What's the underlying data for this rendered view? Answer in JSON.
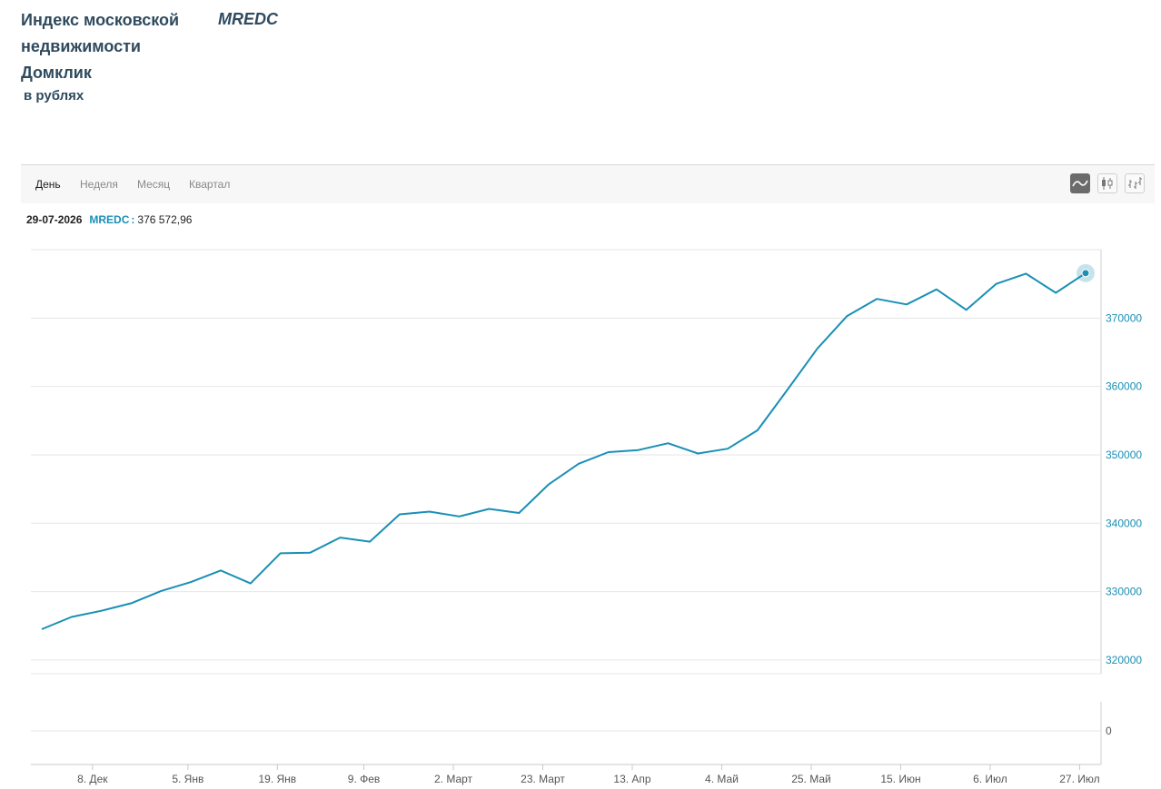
{
  "header": {
    "title_lines": [
      "Индекс московской",
      "недвижимости",
      "Домклик"
    ],
    "ticker": "MREDC",
    "units": "в рублях"
  },
  "tabs": [
    {
      "label": "День",
      "active": true
    },
    {
      "label": "Неделя",
      "active": false
    },
    {
      "label": "Месяц",
      "active": false
    },
    {
      "label": "Квартал",
      "active": false
    }
  ],
  "chart_types": [
    {
      "icon": "line-chart-icon",
      "active": true
    },
    {
      "icon": "candlestick-chart-icon",
      "active": false
    },
    {
      "icon": "ohlc-bar-chart-icon",
      "active": false
    }
  ],
  "readout": {
    "date": "29-07-2026",
    "symbol": "MREDC",
    "value": "376 572,96"
  },
  "colors": {
    "line": "#1a8fb5",
    "axis_text": "#1a8fb5",
    "grid": "#e6e6e6",
    "title": "#2f4a5e"
  },
  "chart_data": {
    "type": "line",
    "series": [
      {
        "values": [
          324500,
          326300,
          327200,
          328300,
          330100,
          331400,
          333100,
          331200,
          335600,
          335700,
          337900,
          337300,
          341300,
          341700,
          341000,
          342100,
          341500,
          345700,
          348700,
          350400,
          350700,
          351700,
          350200,
          350900,
          353600,
          359500,
          365500,
          370300,
          372800,
          372000,
          374200,
          371200,
          375000,
          376500,
          373700,
          376573
        ]
      }
    ],
    "x_tick_labels": [
      "8. Дек",
      "5. Янв",
      "19. Янв",
      "9. Фев",
      "2. Март",
      "23. Март",
      "13. Апр",
      "4. Май",
      "25. Май",
      "15. Июн",
      "6. Июл",
      "27. Июл"
    ],
    "x_tick_positions": [
      1.7,
      4.9,
      7.9,
      10.8,
      13.8,
      16.8,
      19.8,
      22.8,
      25.8,
      28.8,
      31.8,
      34.8
    ],
    "y_ticks": [
      320000,
      330000,
      340000,
      350000,
      360000,
      370000
    ],
    "ylim": [
      318000,
      380000
    ],
    "lower_pane_ticks": [
      0
    ],
    "grid": true,
    "last_point_marker": true
  }
}
